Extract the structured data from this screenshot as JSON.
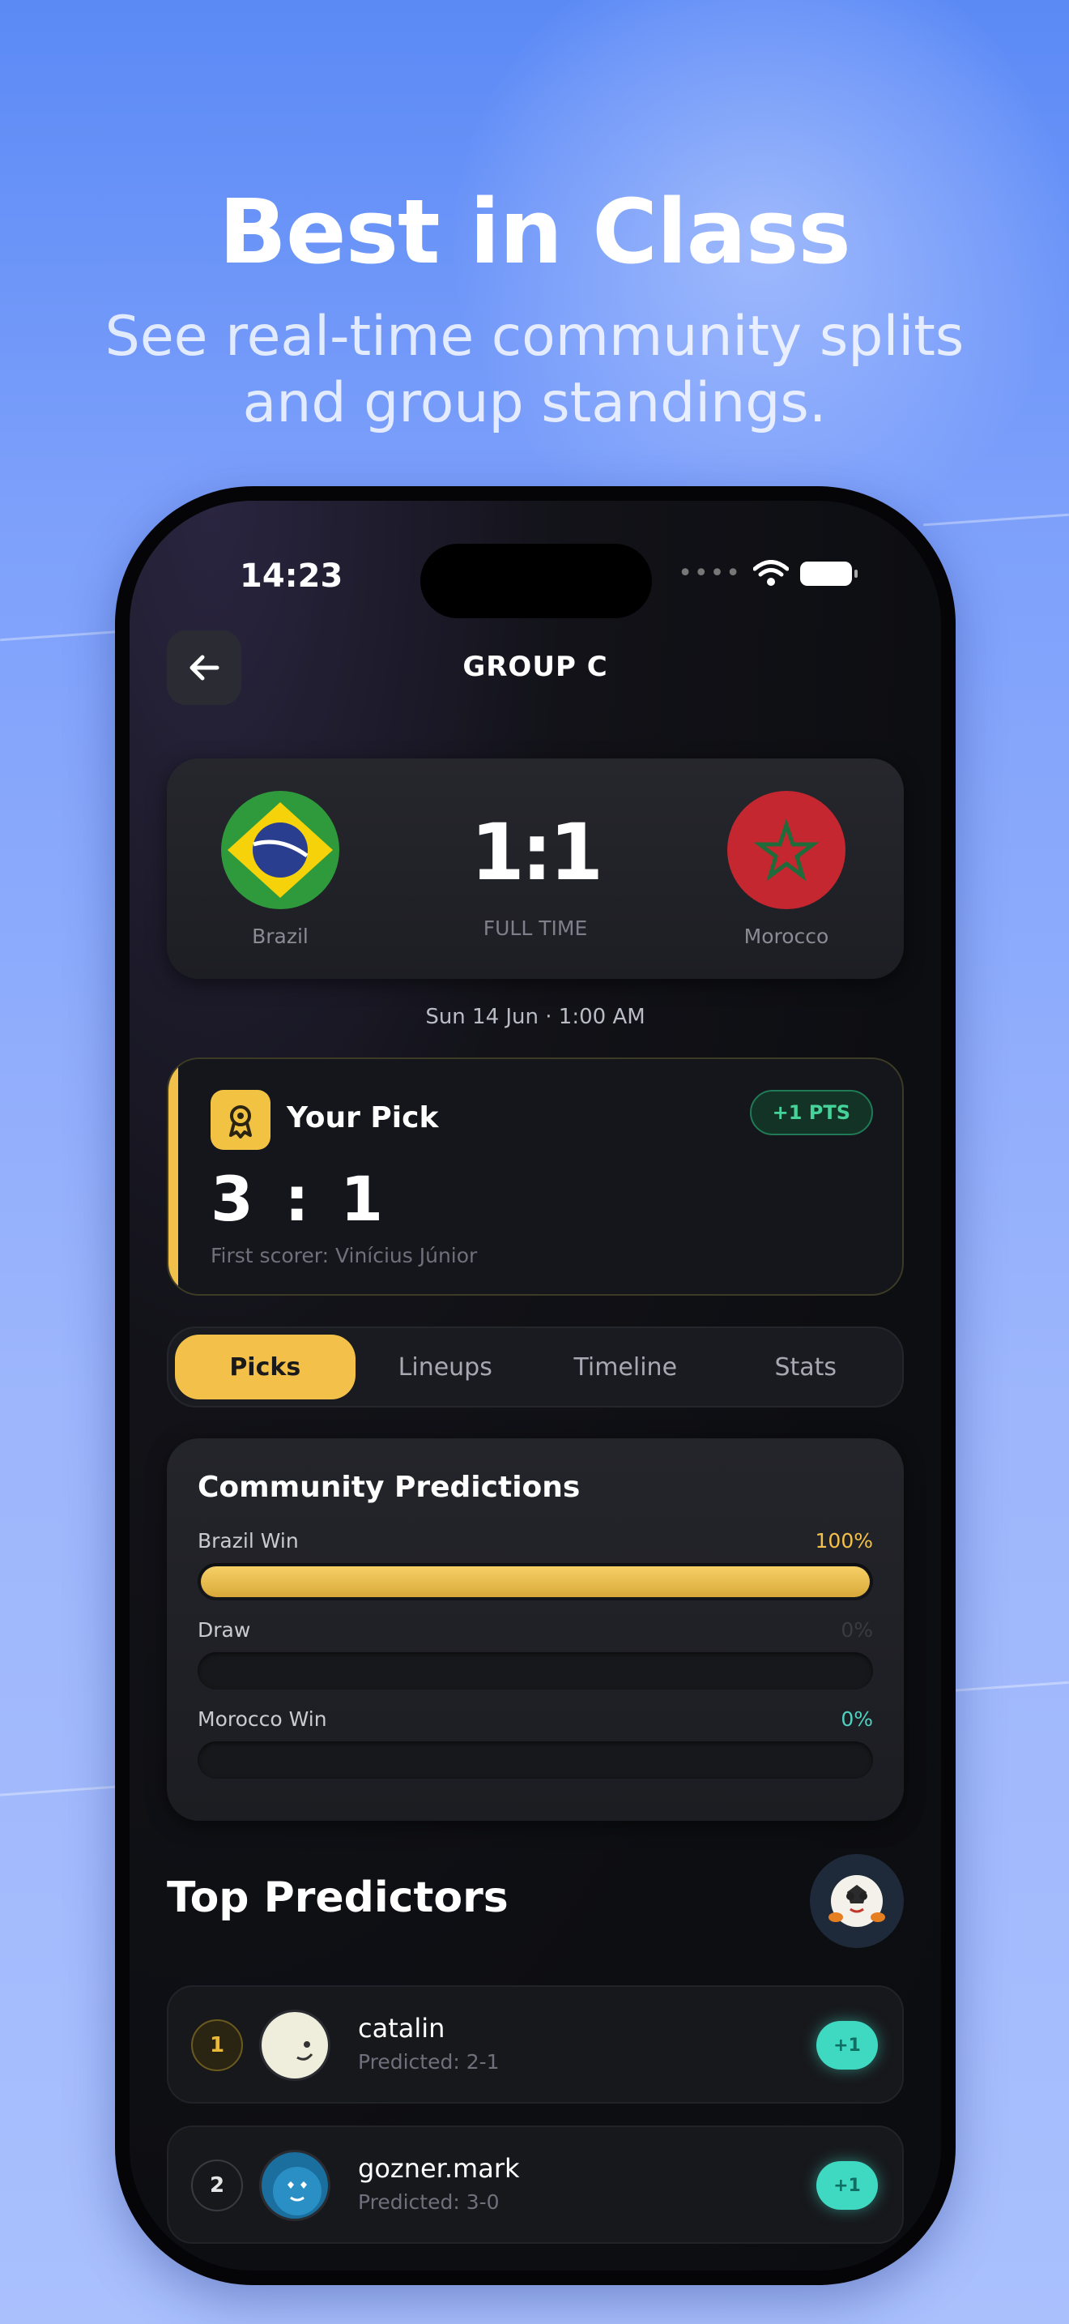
{
  "hero": {
    "title": "Best in Class",
    "subtitle": "See real-time community splits and group standings."
  },
  "status_bar": {
    "time": "14:23"
  },
  "header": {
    "title": "GROUP C",
    "back_icon": "arrow-left-icon"
  },
  "match": {
    "home_team": "Brazil",
    "away_team": "Morocco",
    "score": "1:1",
    "status": "FULL TIME",
    "kickoff": "Sun 14 Jun · 1:00 AM"
  },
  "your_pick": {
    "title": "Your Pick",
    "points_badge": "+1 PTS",
    "score": "3 : 1",
    "first_scorer": "First scorer: Vinícius Júnior",
    "accent": "#f0c04a"
  },
  "tabs": [
    {
      "label": "Picks",
      "active": true
    },
    {
      "label": "Lineups",
      "active": false
    },
    {
      "label": "Timeline",
      "active": false
    },
    {
      "label": "Stats",
      "active": false
    }
  ],
  "community": {
    "title": "Community Predictions",
    "rows": [
      {
        "label": "Brazil Win",
        "pct": "100%",
        "fraction": 1.0,
        "color": "#f3c049"
      },
      {
        "label": "Draw",
        "pct": "0%",
        "fraction": 0.0,
        "color": "#3a3b42"
      },
      {
        "label": "Morocco Win",
        "pct": "0%",
        "fraction": 0.0,
        "color": "#4fd1c0"
      }
    ]
  },
  "top_predictors": {
    "title": "Top Predictors",
    "items": [
      {
        "rank": "1",
        "name": "catalin",
        "predicted": "Predicted: 2-1",
        "points": "+1"
      },
      {
        "rank": "2",
        "name": "gozner.mark",
        "predicted": "Predicted: 3-0",
        "points": "+1"
      }
    ]
  }
}
